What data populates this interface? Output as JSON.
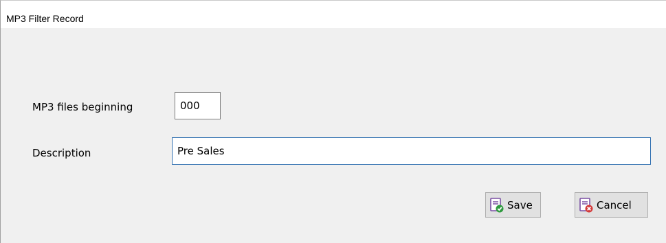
{
  "window": {
    "title": "MP3 Filter Record"
  },
  "form": {
    "mp3_label": "MP3 files beginning",
    "mp3_value": "000",
    "description_label": "Description",
    "description_value": "Pre Sales"
  },
  "buttons": {
    "save_label": "Save",
    "cancel_label": "Cancel",
    "save_icon": "save-record-check-icon",
    "cancel_icon": "cancel-record-x-icon"
  },
  "colors": {
    "focus_border": "#2f6fb0",
    "icon_purple": "#7a4fa3",
    "check_green": "#2e9a3e",
    "cancel_red": "#d33a3a"
  }
}
